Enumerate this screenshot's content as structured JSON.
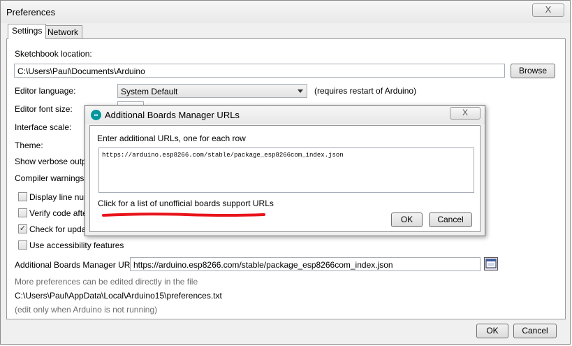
{
  "window": {
    "title": "Preferences",
    "close_label": "X"
  },
  "tabs": [
    {
      "label": "Settings"
    },
    {
      "label": "Network"
    }
  ],
  "settings": {
    "sketchbook_label": "Sketchbook location:",
    "sketchbook_value": "C:\\Users\\Paul\\Documents\\Arduino",
    "browse_label": "Browse",
    "editor_language_label": "Editor language:",
    "editor_language_value": "System Default",
    "editor_language_note": "(requires restart of Arduino)",
    "editor_font_size_label": "Editor font size:",
    "interface_scale_label": "Interface scale:",
    "theme_label": "Theme:",
    "verbose_label": "Show verbose output",
    "compiler_warnings_label": "Compiler warnings:",
    "checkboxes": [
      {
        "label": "Display line numb",
        "checked": false
      },
      {
        "label": "Verify code after",
        "checked": false
      },
      {
        "label": "Check for update",
        "checked": true
      },
      {
        "label": "Use accessibility features",
        "checked": false
      }
    ],
    "boards_urls_label": "Additional Boards Manager URLs:",
    "boards_urls_value": "https://arduino.esp8266.com/stable/package_esp8266com_index.json",
    "more_prefs_note": "More preferences can be edited directly in the file",
    "prefs_path": "C:\\Users\\Paul\\AppData\\Local\\Arduino15\\preferences.txt",
    "edit_note": "(edit only when Arduino is not running)",
    "ok_label": "OK",
    "cancel_label": "Cancel"
  },
  "dialog": {
    "title": "Additional Boards Manager URLs",
    "close_label": "X",
    "instruction": "Enter additional URLs, one for each row",
    "urls_text": "https://arduino.esp8266.com/stable/package_esp8266com_index.json",
    "link_text": "Click for a list of unofficial boards support URLs",
    "ok_label": "OK",
    "cancel_label": "Cancel"
  },
  "colors": {
    "annotation_red": "#e8141b",
    "arduino_teal": "#00979c"
  }
}
